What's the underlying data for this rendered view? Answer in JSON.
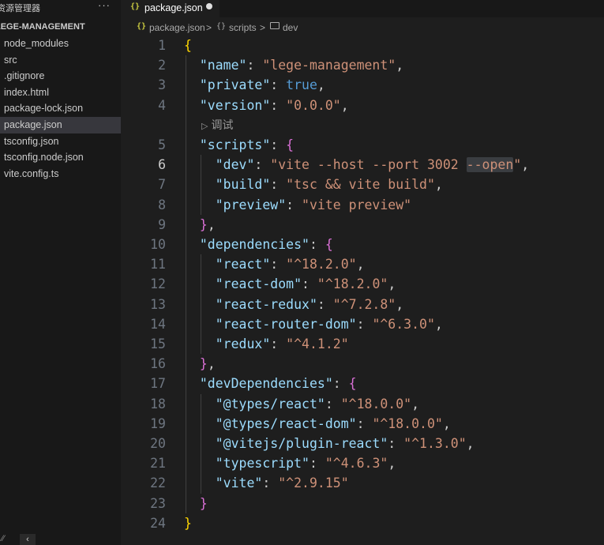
{
  "explorer": {
    "header": "资源管理器",
    "more": "···",
    "project": "LEGE-MANAGEMENT",
    "items": [
      {
        "label": "node_modules"
      },
      {
        "label": "src"
      },
      {
        "label": ".gitignore"
      },
      {
        "label": "index.html"
      },
      {
        "label": "package-lock.json"
      },
      {
        "label": "package.json"
      },
      {
        "label": "tsconfig.json"
      },
      {
        "label": "tsconfig.node.json"
      },
      {
        "label": "vite.config.ts"
      }
    ],
    "active_index": 5
  },
  "tab": {
    "icon": "{}",
    "label": "package.json",
    "modified": true
  },
  "breadcrumb": {
    "icon": "{}",
    "file": "package.json",
    "sep": ">",
    "scripts_icon": "{}",
    "section": "scripts",
    "key": "dev"
  },
  "editor": {
    "current_line": 6,
    "codelens": "调试",
    "codelens_icon": "▷",
    "lines": [
      {
        "n": "1",
        "segs": [
          {
            "c": "br1",
            "t": "{"
          }
        ]
      },
      {
        "n": "2",
        "segs": [
          {
            "c": "p",
            "t": "  "
          },
          {
            "c": "k",
            "t": "\"name\""
          },
          {
            "c": "p",
            "t": ": "
          },
          {
            "c": "s",
            "t": "\"lege-management\""
          },
          {
            "c": "p",
            "t": ","
          }
        ]
      },
      {
        "n": "3",
        "segs": [
          {
            "c": "p",
            "t": "  "
          },
          {
            "c": "k",
            "t": "\"private\""
          },
          {
            "c": "p",
            "t": ": "
          },
          {
            "c": "b",
            "t": "true"
          },
          {
            "c": "p",
            "t": ","
          }
        ]
      },
      {
        "n": "4",
        "segs": [
          {
            "c": "p",
            "t": "  "
          },
          {
            "c": "k",
            "t": "\"version\""
          },
          {
            "c": "p",
            "t": ": "
          },
          {
            "c": "s",
            "t": "\"0.0.0\""
          },
          {
            "c": "p",
            "t": ","
          }
        ]
      },
      {
        "n": "5",
        "segs": [
          {
            "c": "p",
            "t": "  "
          },
          {
            "c": "k",
            "t": "\"scripts\""
          },
          {
            "c": "p",
            "t": ": "
          },
          {
            "c": "br2",
            "t": "{"
          }
        ]
      },
      {
        "n": "6",
        "segs": [
          {
            "c": "p",
            "t": "    "
          },
          {
            "c": "k",
            "t": "\"dev\""
          },
          {
            "c": "p",
            "t": ": "
          },
          {
            "c": "s",
            "t": "\"vite --host --port 3002 "
          },
          {
            "c": "s hl",
            "t": "--open"
          },
          {
            "c": "s",
            "t": "\""
          },
          {
            "c": "p",
            "t": ","
          }
        ]
      },
      {
        "n": "7",
        "segs": [
          {
            "c": "p",
            "t": "    "
          },
          {
            "c": "k",
            "t": "\"build\""
          },
          {
            "c": "p",
            "t": ": "
          },
          {
            "c": "s",
            "t": "\"tsc && vite build\""
          },
          {
            "c": "p",
            "t": ","
          }
        ]
      },
      {
        "n": "8",
        "segs": [
          {
            "c": "p",
            "t": "    "
          },
          {
            "c": "k",
            "t": "\"preview\""
          },
          {
            "c": "p",
            "t": ": "
          },
          {
            "c": "s",
            "t": "\"vite preview\""
          }
        ]
      },
      {
        "n": "9",
        "segs": [
          {
            "c": "p",
            "t": "  "
          },
          {
            "c": "br2",
            "t": "}"
          },
          {
            "c": "p",
            "t": ","
          }
        ]
      },
      {
        "n": "10",
        "segs": [
          {
            "c": "p",
            "t": "  "
          },
          {
            "c": "k",
            "t": "\"dependencies\""
          },
          {
            "c": "p",
            "t": ": "
          },
          {
            "c": "br2",
            "t": "{"
          }
        ]
      },
      {
        "n": "11",
        "segs": [
          {
            "c": "p",
            "t": "    "
          },
          {
            "c": "k",
            "t": "\"react\""
          },
          {
            "c": "p",
            "t": ": "
          },
          {
            "c": "s",
            "t": "\"^18.2.0\""
          },
          {
            "c": "p",
            "t": ","
          }
        ]
      },
      {
        "n": "12",
        "segs": [
          {
            "c": "p",
            "t": "    "
          },
          {
            "c": "k",
            "t": "\"react-dom\""
          },
          {
            "c": "p",
            "t": ": "
          },
          {
            "c": "s",
            "t": "\"^18.2.0\""
          },
          {
            "c": "p",
            "t": ","
          }
        ]
      },
      {
        "n": "13",
        "segs": [
          {
            "c": "p",
            "t": "    "
          },
          {
            "c": "k",
            "t": "\"react-redux\""
          },
          {
            "c": "p",
            "t": ": "
          },
          {
            "c": "s",
            "t": "\"^7.2.8\""
          },
          {
            "c": "p",
            "t": ","
          }
        ]
      },
      {
        "n": "14",
        "segs": [
          {
            "c": "p",
            "t": "    "
          },
          {
            "c": "k",
            "t": "\"react-router-dom\""
          },
          {
            "c": "p",
            "t": ": "
          },
          {
            "c": "s",
            "t": "\"^6.3.0\""
          },
          {
            "c": "p",
            "t": ","
          }
        ]
      },
      {
        "n": "15",
        "segs": [
          {
            "c": "p",
            "t": "    "
          },
          {
            "c": "k",
            "t": "\"redux\""
          },
          {
            "c": "p",
            "t": ": "
          },
          {
            "c": "s",
            "t": "\"^4.1.2\""
          }
        ]
      },
      {
        "n": "16",
        "segs": [
          {
            "c": "p",
            "t": "  "
          },
          {
            "c": "br2",
            "t": "}"
          },
          {
            "c": "p",
            "t": ","
          }
        ]
      },
      {
        "n": "17",
        "segs": [
          {
            "c": "p",
            "t": "  "
          },
          {
            "c": "k",
            "t": "\"devDependencies\""
          },
          {
            "c": "p",
            "t": ": "
          },
          {
            "c": "br2",
            "t": "{"
          }
        ]
      },
      {
        "n": "18",
        "segs": [
          {
            "c": "p",
            "t": "    "
          },
          {
            "c": "k",
            "t": "\"@types/react\""
          },
          {
            "c": "p",
            "t": ": "
          },
          {
            "c": "s",
            "t": "\"^18.0.0\""
          },
          {
            "c": "p",
            "t": ","
          }
        ]
      },
      {
        "n": "19",
        "segs": [
          {
            "c": "p",
            "t": "    "
          },
          {
            "c": "k",
            "t": "\"@types/react-dom\""
          },
          {
            "c": "p",
            "t": ": "
          },
          {
            "c": "s",
            "t": "\"^18.0.0\""
          },
          {
            "c": "p",
            "t": ","
          }
        ]
      },
      {
        "n": "20",
        "segs": [
          {
            "c": "p",
            "t": "    "
          },
          {
            "c": "k",
            "t": "\"@vitejs/plugin-react\""
          },
          {
            "c": "p",
            "t": ": "
          },
          {
            "c": "s",
            "t": "\"^1.3.0\""
          },
          {
            "c": "p",
            "t": ","
          }
        ]
      },
      {
        "n": "21",
        "segs": [
          {
            "c": "p",
            "t": "    "
          },
          {
            "c": "k",
            "t": "\"typescript\""
          },
          {
            "c": "p",
            "t": ": "
          },
          {
            "c": "s",
            "t": "\"^4.6.3\""
          },
          {
            "c": "p",
            "t": ","
          }
        ]
      },
      {
        "n": "22",
        "segs": [
          {
            "c": "p",
            "t": "    "
          },
          {
            "c": "k",
            "t": "\"vite\""
          },
          {
            "c": "p",
            "t": ": "
          },
          {
            "c": "s",
            "t": "\"^2.9.15\""
          }
        ]
      },
      {
        "n": "23",
        "segs": [
          {
            "c": "p",
            "t": "  "
          },
          {
            "c": "br2",
            "t": "}"
          }
        ]
      },
      {
        "n": "24",
        "segs": [
          {
            "c": "br1",
            "t": "}"
          }
        ]
      }
    ]
  },
  "colors": {
    "background": "#1e1e1e",
    "sidebar": "#181818",
    "key": "#9cdcfe",
    "string": "#ce9178",
    "boolean": "#569cd6",
    "bracket_level1": "#ffd700",
    "bracket_level2": "#da70d6"
  }
}
